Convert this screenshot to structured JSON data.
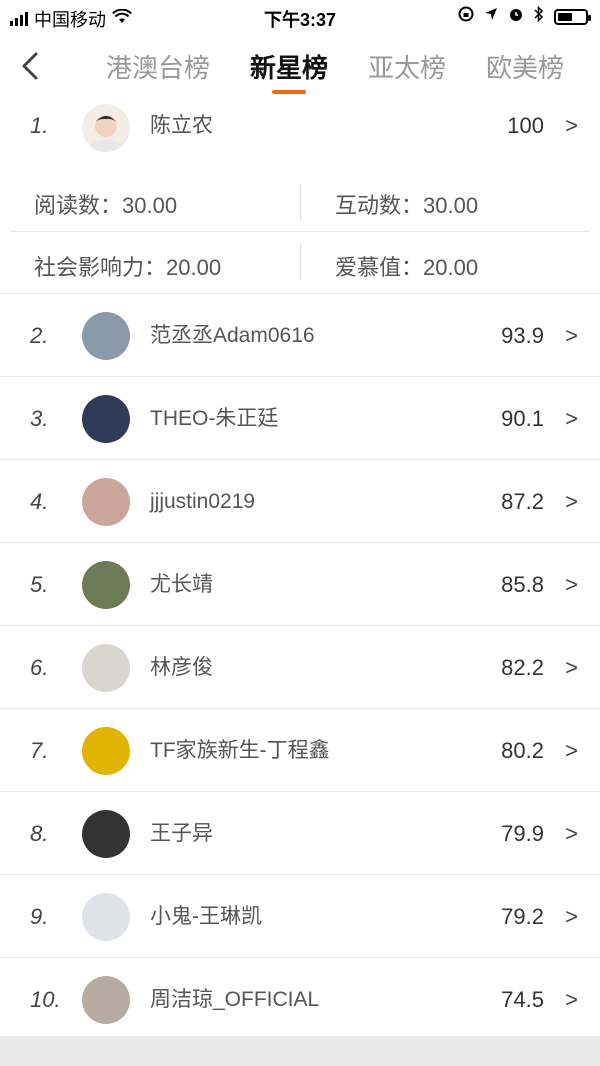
{
  "status_bar": {
    "carrier": "中国移动",
    "time": "下午3:37",
    "icons": [
      "signal-icon",
      "wifi-icon",
      "location-lock-icon",
      "navigation-icon",
      "alarm-icon",
      "bluetooth-icon",
      "battery-icon"
    ]
  },
  "nav": {
    "back_icon": "chevron-left-icon",
    "tabs": [
      {
        "label": "港澳台榜"
      },
      {
        "label": "新星榜"
      },
      {
        "label": "亚太榜"
      },
      {
        "label": "欧美榜"
      }
    ],
    "active_tab_index": 1,
    "accent_color": "#f36a14"
  },
  "top_entry": {
    "rank": "1.",
    "name": "陈立农",
    "score": "100",
    "chevron": ">",
    "stats": {
      "reads": "阅读数：30.00",
      "interactions": "互动数：30.00",
      "influence": "社会影响力：20.00",
      "admiration": "爱慕值：20.00"
    }
  },
  "entries": [
    {
      "rank": "2.",
      "name": "范丞丞Adam0616",
      "score": "93.9",
      "chevron": ">",
      "avatar_color": "#8a9aa8"
    },
    {
      "rank": "3.",
      "name": "THEO-朱正廷",
      "score": "90.1",
      "chevron": ">",
      "avatar_color": "#2f3b57"
    },
    {
      "rank": "4.",
      "name": "jjjustin0219",
      "score": "87.2",
      "chevron": ">",
      "avatar_color": "#c9a59a"
    },
    {
      "rank": "5.",
      "name": "尤长靖",
      "score": "85.8",
      "chevron": ">",
      "avatar_color": "#6d7a56"
    },
    {
      "rank": "6.",
      "name": "林彦俊",
      "score": "82.2",
      "chevron": ">",
      "avatar_color": "#d9d6d0"
    },
    {
      "rank": "7.",
      "name": "TF家族新生-丁程鑫",
      "score": "80.2",
      "chevron": ">",
      "avatar_color": "#e0b400"
    },
    {
      "rank": "8.",
      "name": "王子异",
      "score": "79.9",
      "chevron": ">",
      "avatar_color": "#333333"
    },
    {
      "rank": "9.",
      "name": "小鬼-王琳凯",
      "score": "79.2",
      "chevron": ">",
      "avatar_color": "#dfe3e8"
    },
    {
      "rank": "10.",
      "name": "周洁琼_OFFICIAL",
      "score": "74.5",
      "chevron": ">",
      "avatar_color": "#b6aba0"
    }
  ]
}
